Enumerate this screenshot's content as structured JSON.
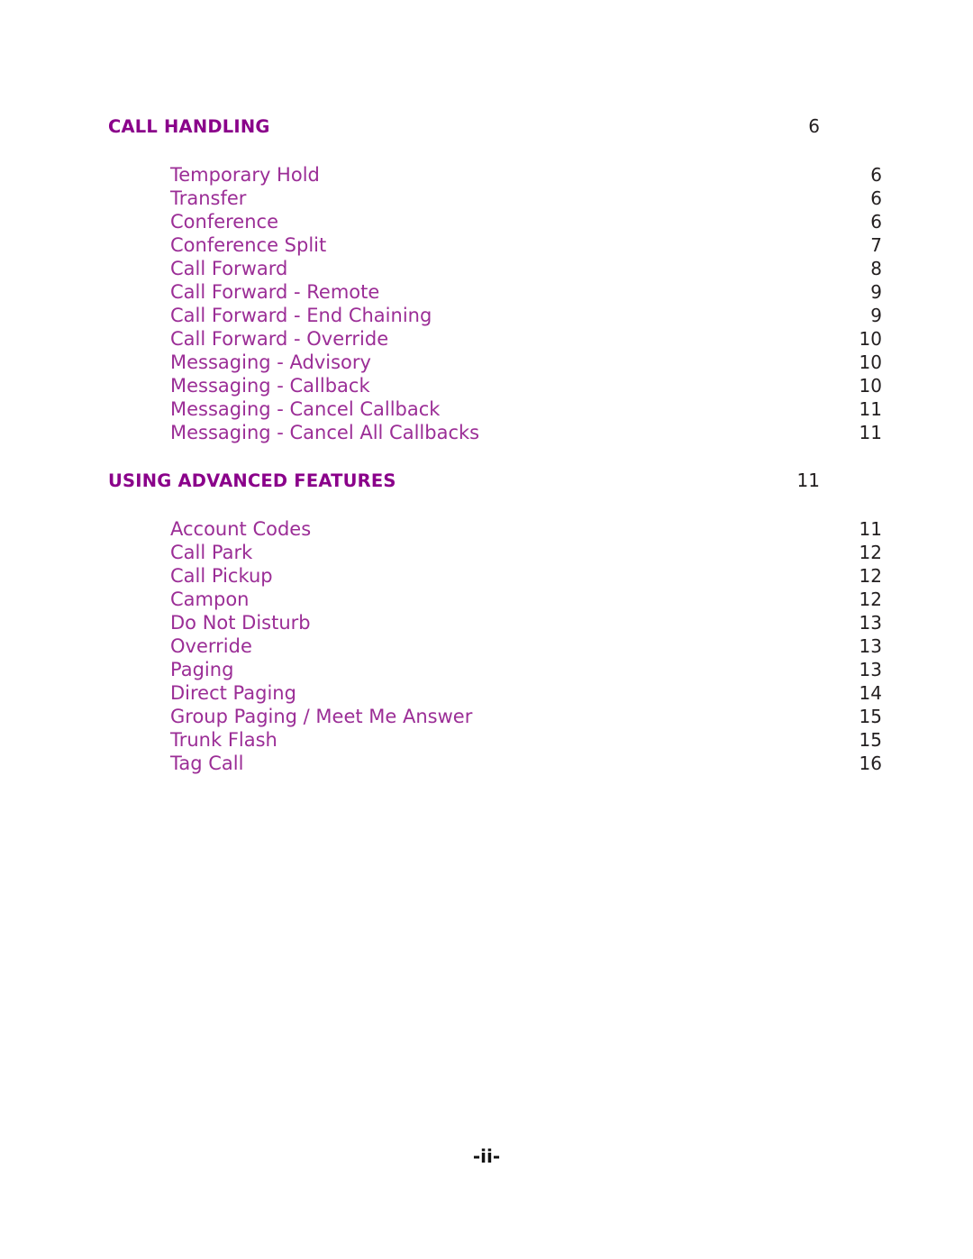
{
  "document": {
    "type": "table-of-contents",
    "page_marker": "-ii-",
    "colors": {
      "heading": "#8A008A",
      "entry": "#9B2D96",
      "page_number": "#231F20",
      "background": "#FFFFFF",
      "footer": "#111111"
    }
  },
  "sections": [
    {
      "heading": "CALL HANDLING",
      "heading_page": "6",
      "entries": [
        {
          "label": "Temporary Hold",
          "page": "6"
        },
        {
          "label": "Transfer",
          "page": "6"
        },
        {
          "label": "Conference",
          "page": "6"
        },
        {
          "label": "Conference Split",
          "page": "7"
        },
        {
          "label": "Call Forward",
          "page": "8"
        },
        {
          "label": "Call Forward - Remote",
          "page": "9"
        },
        {
          "label": "Call Forward - End Chaining",
          "page": "9"
        },
        {
          "label": "Call Forward - Override",
          "page": "10"
        },
        {
          "label": "Messaging - Advisory",
          "page": "10"
        },
        {
          "label": "Messaging - Callback",
          "page": "10"
        },
        {
          "label": "Messaging - Cancel Callback",
          "page": "11"
        },
        {
          "label": "Messaging - Cancel All Callbacks",
          "page": "11"
        }
      ]
    },
    {
      "heading": "USING ADVANCED FEATURES",
      "heading_page": "11",
      "entries": [
        {
          "label": "Account Codes",
          "page": "11"
        },
        {
          "label": "Call Park",
          "page": "12"
        },
        {
          "label": "Call Pickup",
          "page": "12"
        },
        {
          "label": "Campon",
          "page": "12"
        },
        {
          "label": "Do Not Disturb",
          "page": "13"
        },
        {
          "label": "Override",
          "page": "13"
        },
        {
          "label": "Paging",
          "page": "13"
        },
        {
          "label": "Direct Paging",
          "page": "14"
        },
        {
          "label": "Group Paging / Meet Me Answer",
          "page": "15"
        },
        {
          "label": "Trunk Flash",
          "page": "15"
        },
        {
          "label": "Tag Call",
          "page": "16"
        }
      ]
    }
  ]
}
